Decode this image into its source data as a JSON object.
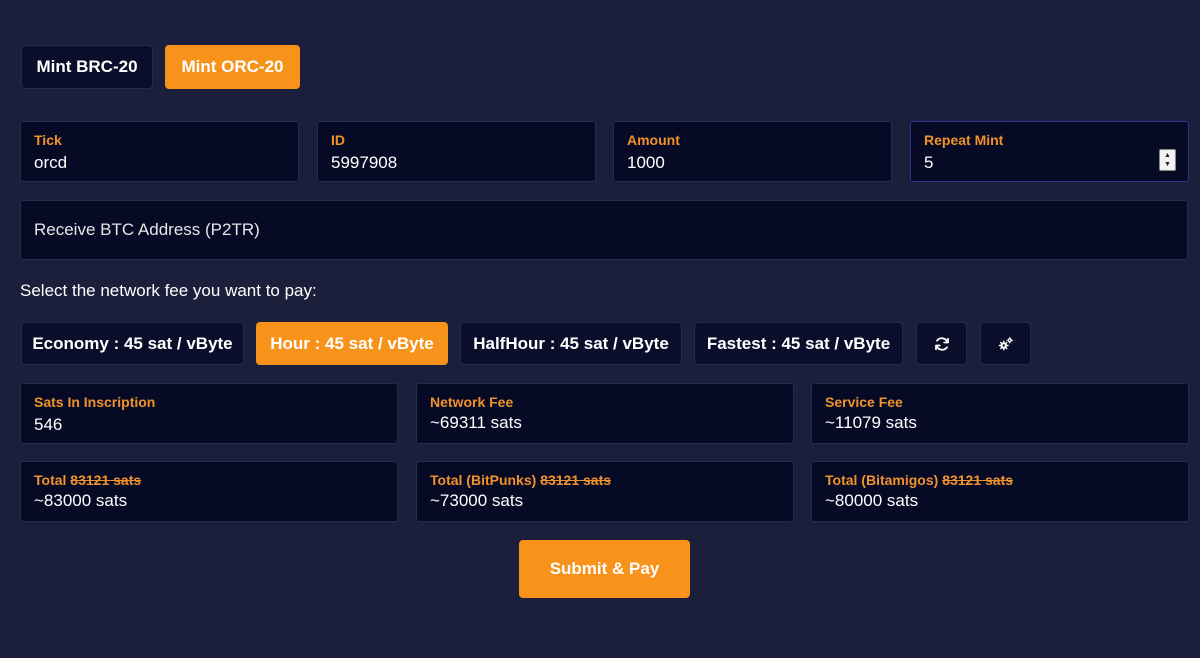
{
  "tabs": {
    "brc20": "Mint BRC-20",
    "orc20": "Mint ORC-20"
  },
  "form": {
    "tick": {
      "label": "Tick",
      "value": "orcd"
    },
    "id": {
      "label": "ID",
      "value": "5997908"
    },
    "amount": {
      "label": "Amount",
      "value": "1000"
    },
    "repeat_mint": {
      "label": "Repeat Mint",
      "value": "5"
    },
    "address": {
      "placeholder": "Receive BTC Address (P2TR)"
    }
  },
  "fee_prompt": "Select the network fee you want to pay:",
  "fees": {
    "economy": "Economy : 45 sat / vByte",
    "hour": "Hour : 45 sat / vByte",
    "halfhour": "HalfHour : 45 sat / vByte",
    "fastest": "Fastest : 45 sat / vByte",
    "selected": "hour"
  },
  "icons": {
    "refresh": "refresh-icon",
    "settings": "gears-icon"
  },
  "summary": {
    "sats_in_inscription": {
      "label": "Sats In Inscription",
      "value": "546"
    },
    "network_fee": {
      "label": "Network Fee",
      "value": "~69311 sats"
    },
    "service_fee": {
      "label": "Service Fee",
      "value": "~11079 sats"
    },
    "total": {
      "label": "Total",
      "original": "83121 sats",
      "value": "~83000 sats"
    },
    "total_bitpunks": {
      "label": "Total (BitPunks)",
      "original": "83121 sats",
      "value": "~73000 sats"
    },
    "total_bitamigos": {
      "label": "Total (Bitamigos)",
      "original": "83121 sats",
      "value": "~80000 sats"
    }
  },
  "submit_label": "Submit & Pay",
  "colors": {
    "accent": "#f7931a",
    "background": "#1b1f3b",
    "panel": "#060a24",
    "label": "#f0922b"
  }
}
